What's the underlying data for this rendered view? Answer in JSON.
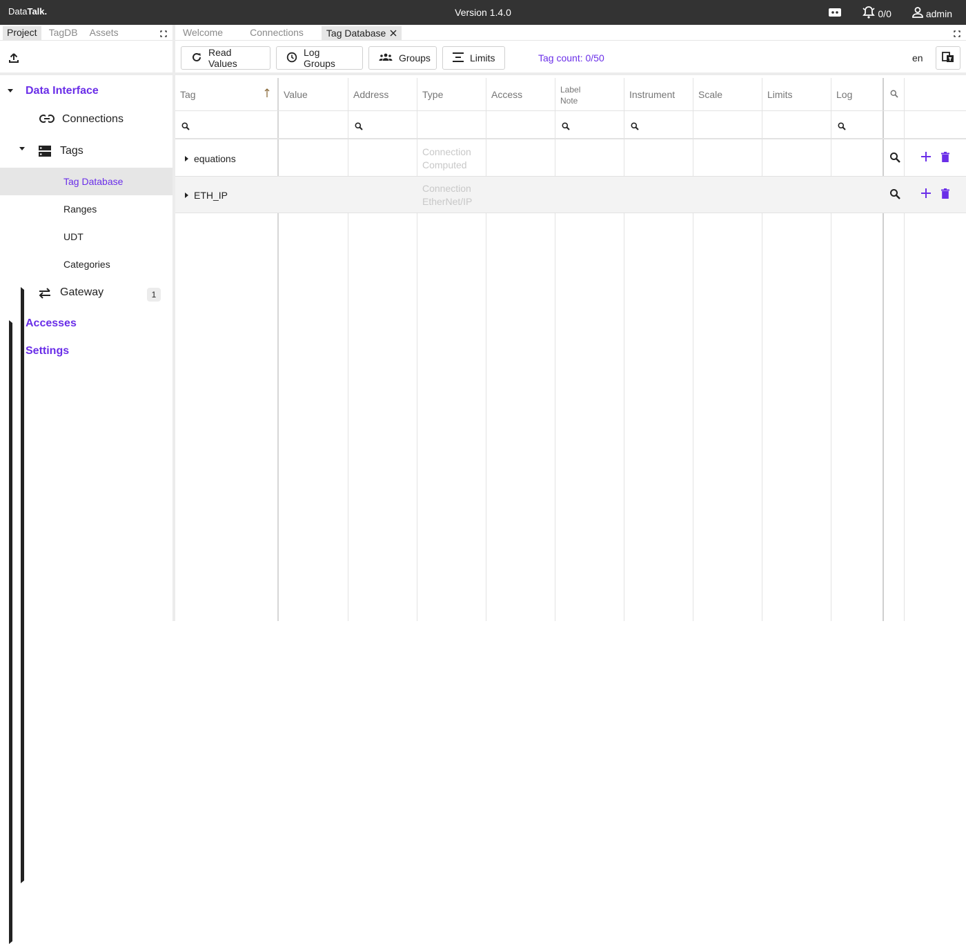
{
  "topbar": {
    "brand_prefix": "Data",
    "brand_bold": "Talk.",
    "version": "Version 1.4.0",
    "alarms": "0/0",
    "user": "admin"
  },
  "left": {
    "tabs": [
      "Project",
      "TagDB",
      "Assets"
    ],
    "tree": {
      "data_interface": "Data Interface",
      "connections": "Connections",
      "tags": "Tags",
      "tags_children": [
        "Tag Database",
        "Ranges",
        "UDT",
        "Categories"
      ],
      "gateway": "Gateway",
      "gateway_badge": "1",
      "accesses": "Accesses",
      "settings": "Settings"
    }
  },
  "right": {
    "tabs": [
      "Welcome",
      "Connections",
      "Tag Database"
    ],
    "toolbar": {
      "read_values": "Read Values",
      "log_groups": "Log Groups",
      "groups": "Groups",
      "limits": "Limits",
      "tag_count": "Tag count: 0/50",
      "lang": "en"
    },
    "table": {
      "headers": {
        "tag": "Tag",
        "value": "Value",
        "address": "Address",
        "type": "Type",
        "access": "Access",
        "label": "Label",
        "note": "Note",
        "instrument": "Instrument",
        "scale": "Scale",
        "limits": "Limits",
        "log": "Log"
      },
      "rows": [
        {
          "name": "equations",
          "type_line1": "Connection",
          "type_line2": "Computed"
        },
        {
          "name": "ETH_IP",
          "type_line1": "Connection",
          "type_line2": "EtherNet/IP"
        }
      ]
    }
  },
  "colors": {
    "accent": "#6a2ee8",
    "topbar": "#333333",
    "selected_bg": "#e6e6e6"
  }
}
